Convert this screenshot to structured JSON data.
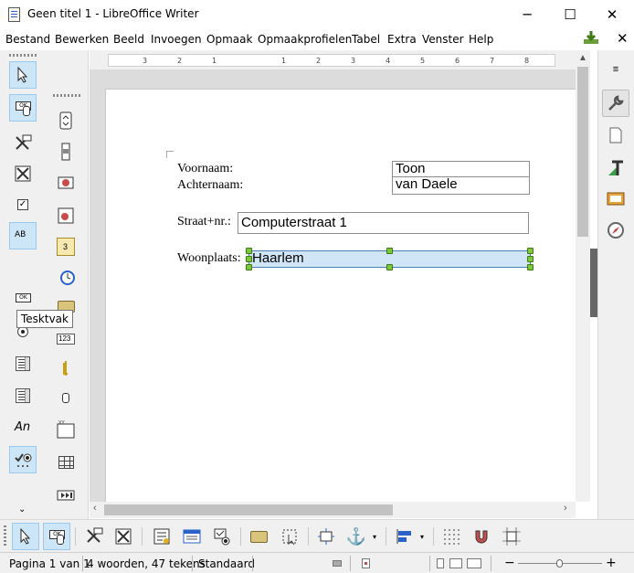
{
  "window": {
    "title": "Geen titel 1 - LibreOffice Writer",
    "minimize": "─",
    "maximize": "☐",
    "close": "✕"
  },
  "menubar": {
    "items": [
      "Bestand",
      "Bewerken",
      "Beeld",
      "Invoegen",
      "Opmaak",
      "Opmaakprofielen",
      "Tabel",
      "Extra",
      "Venster",
      "Help"
    ],
    "close": "✕"
  },
  "left_toolbar": {
    "tooltip": "Tesktvak",
    "icons": [
      "select-icon",
      "push-button-icon",
      "design-mode-icon",
      "control-properties-icon",
      "checkbox-icon",
      "text-box-icon",
      "label-icon",
      "option-button-icon",
      "list-box-icon",
      "combo-box-icon",
      "group-box-icon",
      "toggle-design-icon",
      "spin-button-icon",
      "scrollbar-icon",
      "image-button-icon",
      "image-control-icon",
      "date-field-icon",
      "time-field-icon",
      "file-selection-icon",
      "numeric-field-icon",
      "currency-field-icon",
      "pattern-field-icon",
      "table-control-icon",
      "navigation-bar-icon"
    ],
    "text_box_label": "AB",
    "label_field_label": "An",
    "numeric_label": "123",
    "date_label": "3",
    "ok_label": "OK"
  },
  "ruler": {
    "labels": [
      "3",
      "2",
      "1",
      "1",
      "2",
      "3",
      "4",
      "5",
      "6",
      "7",
      "8"
    ]
  },
  "form": {
    "voornaam_label": "Voornaam:",
    "voornaam_value": "Toon",
    "achternaam_label": "Achternaam:",
    "achternaam_value": "van Daele",
    "straat_label": "Straat+nr.:",
    "straat_value": "Computerstraat 1",
    "woonplaats_label": "Woonplaats:",
    "woonplaats_value": "Haarlem"
  },
  "statusbar": {
    "page": "Pagina 1 van 1",
    "words": "4 woorden, 47 tekens",
    "style": "Standaard",
    "zoom_minus": "−",
    "zoom_plus": "+"
  },
  "colors": {
    "selection": "#cde6f7",
    "handle": "#7ec63a",
    "scrollbar": "#c2c2c2"
  }
}
